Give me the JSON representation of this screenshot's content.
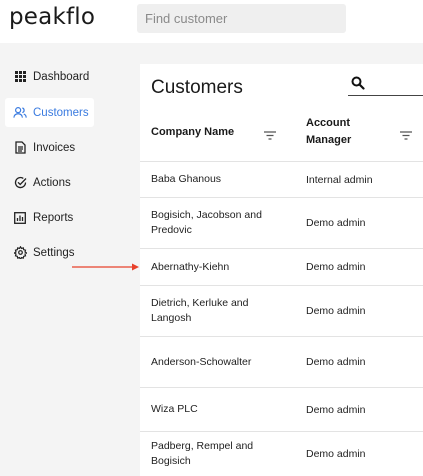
{
  "app": {
    "logo": "peakflo"
  },
  "search": {
    "placeholder": "Find customer"
  },
  "sidebar": {
    "items": [
      {
        "label": "Dashboard",
        "icon": "grid-icon"
      },
      {
        "label": "Customers",
        "icon": "users-icon",
        "active": true
      },
      {
        "label": "Invoices",
        "icon": "document-icon"
      },
      {
        "label": "Actions",
        "icon": "check-circle-icon"
      },
      {
        "label": "Reports",
        "icon": "bar-chart-icon"
      },
      {
        "label": "Settings",
        "icon": "gear-icon"
      }
    ]
  },
  "main": {
    "title": "Customers",
    "columns": {
      "company": "Company Name",
      "manager": "Account Manager"
    },
    "rows": [
      {
        "company": "Baba Ghanous",
        "manager": "Internal admin"
      },
      {
        "company": "Bogisich, Jacobson and Predovic",
        "manager": "Demo admin"
      },
      {
        "company": "Abernathy-Kiehn",
        "manager": "Demo admin"
      },
      {
        "company": "Dietrich, Kerluke and Langosh",
        "manager": "Demo admin"
      },
      {
        "company": "Anderson-Schowalter",
        "manager": "Demo admin"
      },
      {
        "company": "Wiza PLC",
        "manager": "Demo admin"
      },
      {
        "company": "Padberg, Rempel and Bogisich",
        "manager": "Demo admin"
      }
    ]
  },
  "colors": {
    "accent": "#3a7be0",
    "arrow": "#e8402a"
  }
}
